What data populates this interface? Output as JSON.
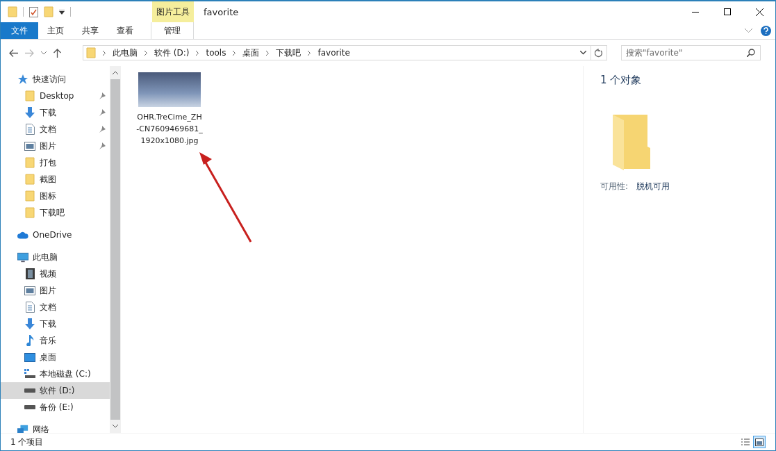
{
  "window": {
    "title": "favorite"
  },
  "context_tab_group": {
    "label": "图片工具"
  },
  "ribbon_tabs": [
    {
      "label": "文件",
      "kind": "file",
      "selected": false
    },
    {
      "label": "主页",
      "kind": "normal",
      "selected": false
    },
    {
      "label": "共享",
      "kind": "normal",
      "selected": false
    },
    {
      "label": "查看",
      "kind": "normal",
      "selected": false
    },
    {
      "label": "管理",
      "kind": "contextual",
      "selected": false
    }
  ],
  "address_bar": {
    "path": [
      "此电脑",
      "软件 (D:)",
      "tools",
      "桌面",
      "下载吧",
      "favorite"
    ]
  },
  "search": {
    "placeholder": "搜索\"favorite\""
  },
  "sidebar": {
    "items": [
      {
        "label": "快速访问",
        "kind": "star",
        "selected": false,
        "children": [
          {
            "label": "Desktop",
            "kind": "folder",
            "pinned": true,
            "selected": false
          },
          {
            "label": "下载",
            "kind": "download",
            "pinned": true,
            "selected": false
          },
          {
            "label": "文档",
            "kind": "document",
            "pinned": true,
            "selected": false
          },
          {
            "label": "图片",
            "kind": "picture",
            "pinned": true,
            "selected": false
          },
          {
            "label": "打包",
            "kind": "folder",
            "pinned": false,
            "selected": false
          },
          {
            "label": "截图",
            "kind": "folder",
            "pinned": false,
            "selected": false
          },
          {
            "label": "图标",
            "kind": "folder",
            "pinned": false,
            "selected": false
          },
          {
            "label": "下载吧",
            "kind": "folder",
            "pinned": false,
            "selected": false
          }
        ]
      },
      {
        "label": "OneDrive",
        "kind": "cloud",
        "selected": false
      },
      {
        "label": "此电脑",
        "kind": "pc",
        "selected": false,
        "children": [
          {
            "label": "视频",
            "kind": "video",
            "pinned": false,
            "selected": false
          },
          {
            "label": "图片",
            "kind": "picture",
            "pinned": false,
            "selected": false
          },
          {
            "label": "文档",
            "kind": "document",
            "pinned": false,
            "selected": false
          },
          {
            "label": "下载",
            "kind": "download",
            "pinned": false,
            "selected": false
          },
          {
            "label": "音乐",
            "kind": "music",
            "pinned": false,
            "selected": false
          },
          {
            "label": "桌面",
            "kind": "desktop",
            "pinned": false,
            "selected": false
          },
          {
            "label": "本地磁盘 (C:)",
            "kind": "system-drive",
            "pinned": false,
            "selected": false
          },
          {
            "label": "软件 (D:)",
            "kind": "drive",
            "pinned": false,
            "selected": true
          },
          {
            "label": "备份 (E:)",
            "kind": "drive",
            "pinned": false,
            "selected": false
          }
        ]
      },
      {
        "label": "网络",
        "kind": "network",
        "selected": false
      }
    ]
  },
  "files": [
    {
      "name": "OHR.TreCime_ZH-CN7609469681_1920x1080.jpg",
      "selected": false
    }
  ],
  "details_pane": {
    "count": "1 个对象",
    "properties": [
      {
        "label": "可用性:",
        "value": "脱机可用"
      }
    ]
  },
  "status_bar": {
    "item_count": "1 个项目"
  },
  "view_buttons": [
    {
      "kind": "details",
      "selected": false
    },
    {
      "kind": "thumbnails",
      "selected": true
    }
  ]
}
